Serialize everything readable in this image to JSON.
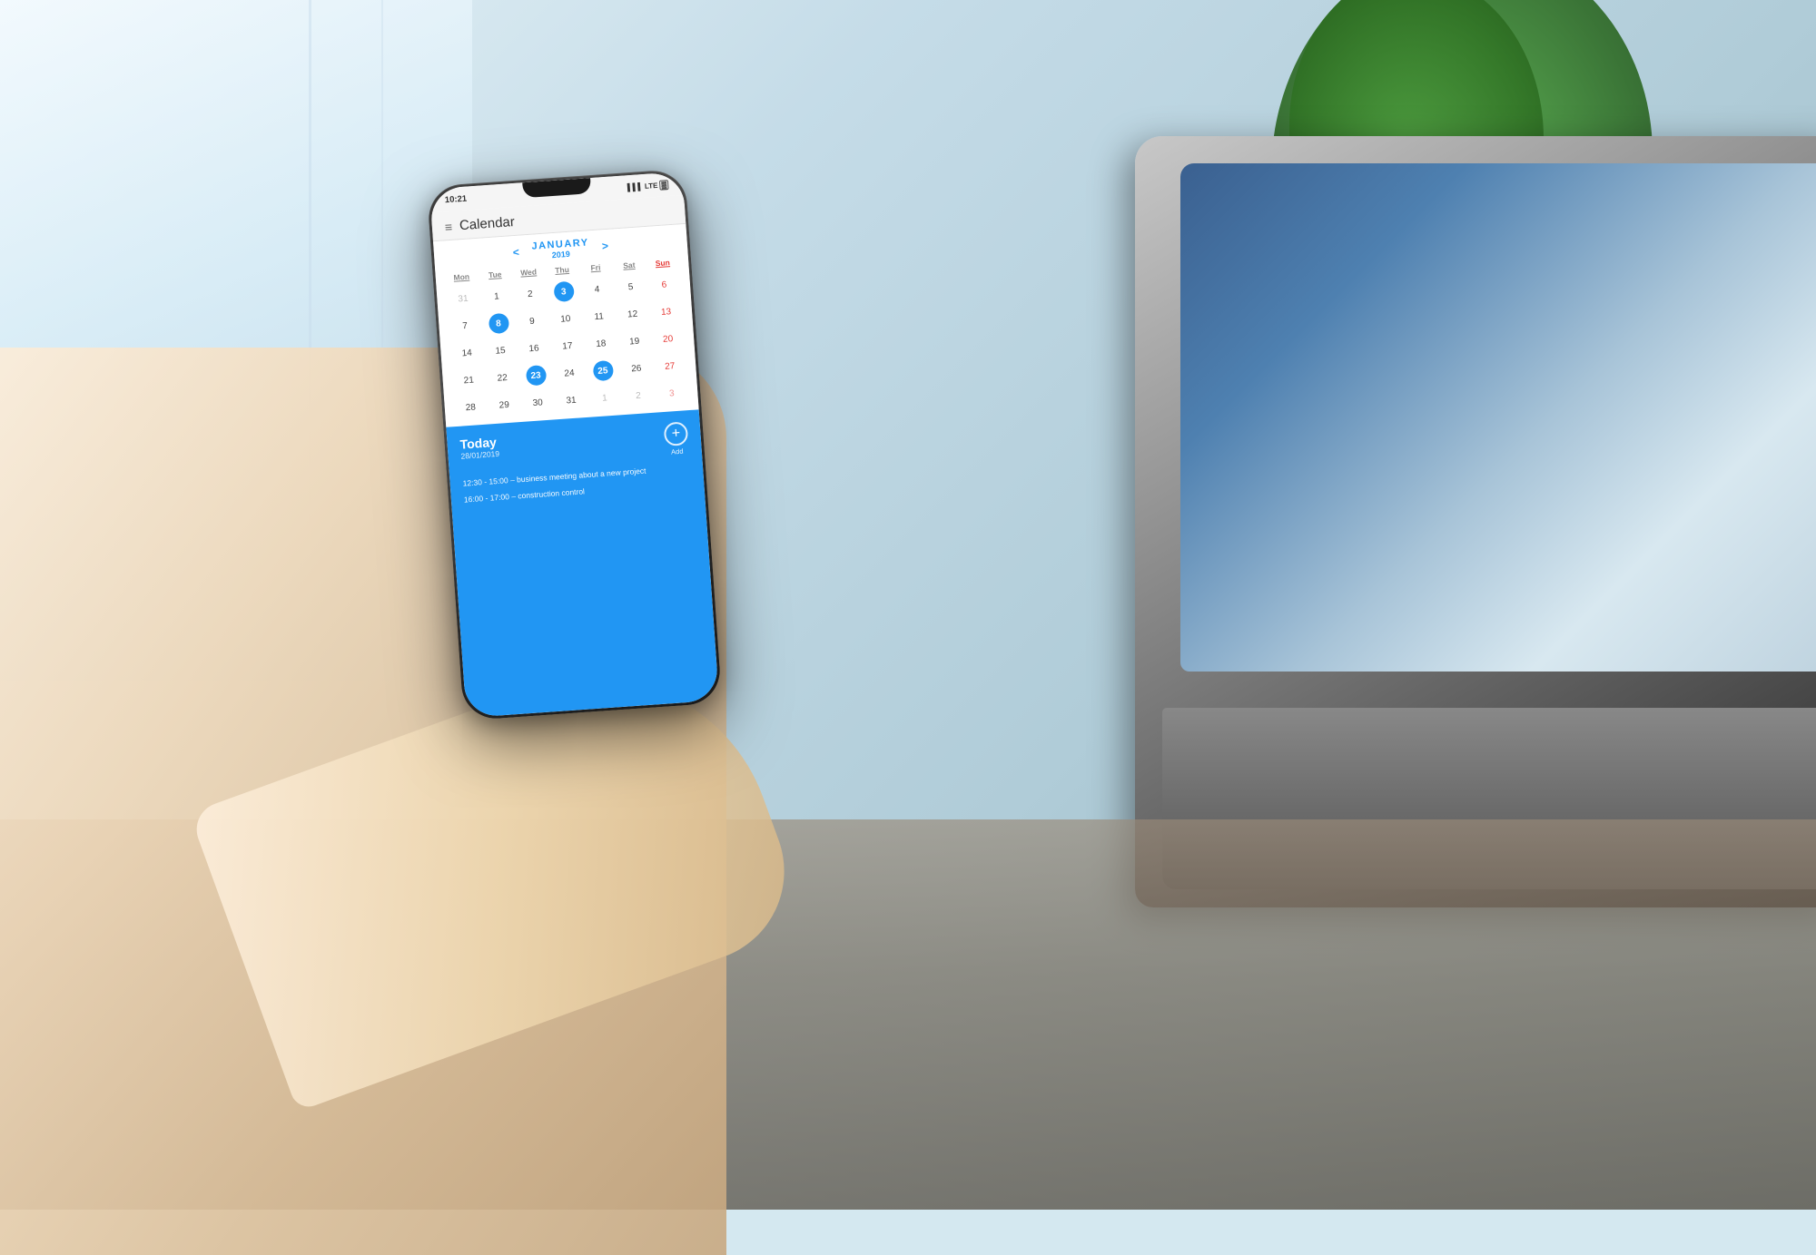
{
  "scene": {
    "background_color": "#c5dce8"
  },
  "phone": {
    "status_bar": {
      "time": "10:21",
      "signal": "▌▌▌",
      "network": "LTE",
      "battery": "▓"
    },
    "app": {
      "title": "Calendar",
      "menu_icon": "≡"
    },
    "calendar": {
      "prev_arrow": "<",
      "next_arrow": ">",
      "month": "JANUARY",
      "year": "2019",
      "day_headers": [
        "Mon",
        "Tue",
        "Wed",
        "Thu",
        "Fri",
        "Sat",
        "Sun"
      ],
      "weeks": [
        [
          {
            "day": "31",
            "type": "other-month"
          },
          {
            "day": "1",
            "type": "normal"
          },
          {
            "day": "2",
            "type": "normal"
          },
          {
            "day": "3",
            "type": "highlighted"
          },
          {
            "day": "4",
            "type": "normal"
          },
          {
            "day": "5",
            "type": "normal"
          },
          {
            "day": "6",
            "type": "sunday"
          }
        ],
        [
          {
            "day": "7",
            "type": "normal"
          },
          {
            "day": "8",
            "type": "highlighted"
          },
          {
            "day": "9",
            "type": "normal"
          },
          {
            "day": "10",
            "type": "normal"
          },
          {
            "day": "11",
            "type": "normal"
          },
          {
            "day": "12",
            "type": "normal"
          },
          {
            "day": "13",
            "type": "sunday"
          }
        ],
        [
          {
            "day": "14",
            "type": "normal"
          },
          {
            "day": "15",
            "type": "normal"
          },
          {
            "day": "16",
            "type": "normal"
          },
          {
            "day": "17",
            "type": "normal"
          },
          {
            "day": "18",
            "type": "normal"
          },
          {
            "day": "19",
            "type": "normal"
          },
          {
            "day": "20",
            "type": "sunday"
          }
        ],
        [
          {
            "day": "21",
            "type": "normal"
          },
          {
            "day": "22",
            "type": "normal"
          },
          {
            "day": "23",
            "type": "highlighted"
          },
          {
            "day": "24",
            "type": "normal"
          },
          {
            "day": "25",
            "type": "highlighted"
          },
          {
            "day": "26",
            "type": "normal"
          },
          {
            "day": "27",
            "type": "sunday"
          }
        ],
        [
          {
            "day": "28",
            "type": "normal"
          },
          {
            "day": "29",
            "type": "normal"
          },
          {
            "day": "30",
            "type": "normal"
          },
          {
            "day": "31",
            "type": "normal"
          },
          {
            "day": "1",
            "type": "other-month"
          },
          {
            "day": "2",
            "type": "other-month"
          },
          {
            "day": "3",
            "type": "other-month-sunday"
          }
        ]
      ]
    },
    "events": {
      "today_label": "Today",
      "date": "28/01/2019",
      "add_label": "Add",
      "items": [
        "12:30 - 15:00 – business meeting about a new project",
        "16:00 - 17:00 – construction control"
      ]
    }
  }
}
